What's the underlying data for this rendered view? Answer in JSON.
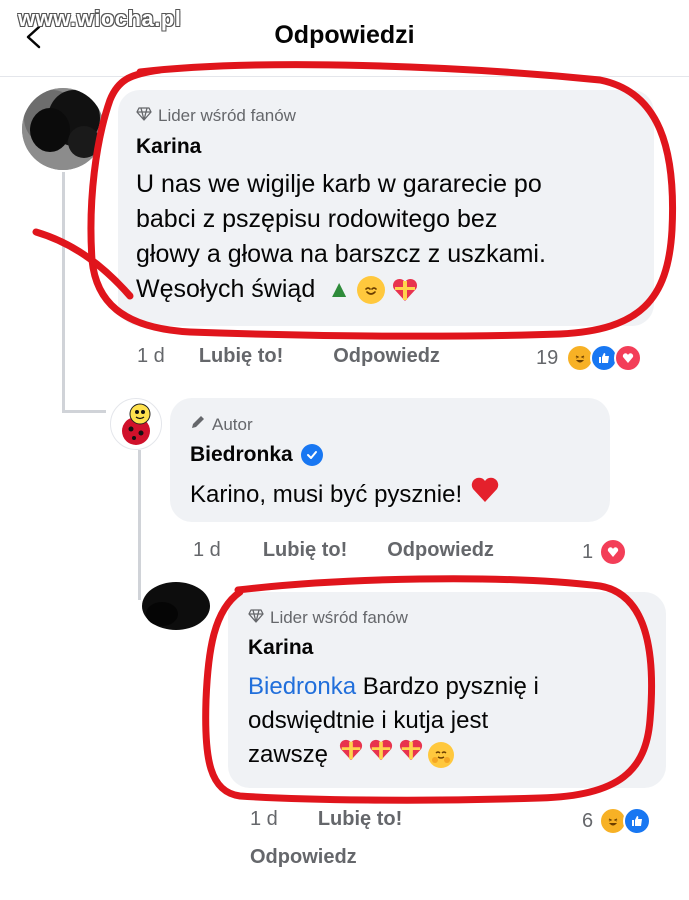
{
  "header": {
    "watermark": "www.wiocha.pl",
    "title": "Odpowiedzi"
  },
  "comments": [
    {
      "badge": "Lider wśród fanów",
      "author": "Karina",
      "lines": [
        "U nas we wigilje karb w gararecie po",
        "babci z pszępisu rodowitego bez",
        "głowy a głowa na barszcz z uszkami.",
        "Węsołych świąd"
      ],
      "time": "1 d",
      "like_label": "Lubię to!",
      "reply_label": "Odpowiedz",
      "reactions_count": "19"
    },
    {
      "badge": "Autor",
      "author": "Biedronka",
      "text": "Karino, musi być pysznie!",
      "time": "1 d",
      "like_label": "Lubię to!",
      "reply_label": "Odpowiedz",
      "reactions_count": "1"
    },
    {
      "badge": "Lider wśród fanów",
      "author": "Karina",
      "mention": "Biedronka",
      "line1": " Bardzo pysznię i",
      "line2": "odswiędtnie i kutja jest",
      "line3": "zawszę",
      "time": "1 d",
      "like_label": "Lubię to!",
      "reply_label": "Odpowiedz",
      "reactions_count": "6"
    }
  ],
  "colors": {
    "bubble": "#f0f2f5",
    "secondary_text": "#65676b",
    "mention": "#216fdb",
    "annotation_red": "#e0151c"
  },
  "icons": [
    "back-arrow-icon",
    "diamond-icon",
    "pencil-icon",
    "verified-icon",
    "heart-icon",
    "tree-emoji",
    "party-emoji",
    "gift-heart-emoji",
    "hug-emoji",
    "haha-reaction",
    "like-reaction",
    "love-reaction"
  ]
}
